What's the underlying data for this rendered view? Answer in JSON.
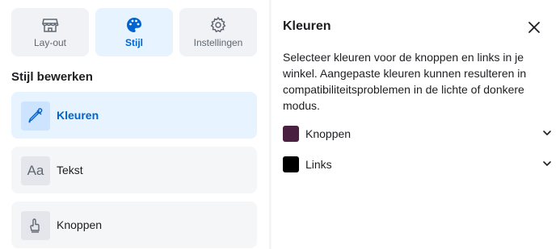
{
  "tabs": [
    {
      "label": "Lay-out",
      "icon": "storefront-icon"
    },
    {
      "label": "Stijl",
      "icon": "palette-icon",
      "active": true
    },
    {
      "label": "Instellingen",
      "icon": "gear-icon"
    }
  ],
  "section_title": "Stijl bewerken",
  "items": [
    {
      "label": "Kleuren",
      "icon": "eyedropper-icon",
      "active": true
    },
    {
      "label": "Tekst",
      "icon": "text-icon"
    },
    {
      "label": "Knoppen",
      "icon": "hand-pointer-icon"
    }
  ],
  "panel": {
    "title": "Kleuren",
    "description": "Selecteer kleuren voor de knoppen en links in je winkel. Aangepaste kleuren kunnen resulteren in compatibiliteitsproblemen in de lichte of donkere modus.",
    "colors": [
      {
        "label": "Knoppen",
        "color": "#4a2040"
      },
      {
        "label": "Links",
        "color": "#000000"
      }
    ]
  },
  "accent_color": "#0064d1"
}
